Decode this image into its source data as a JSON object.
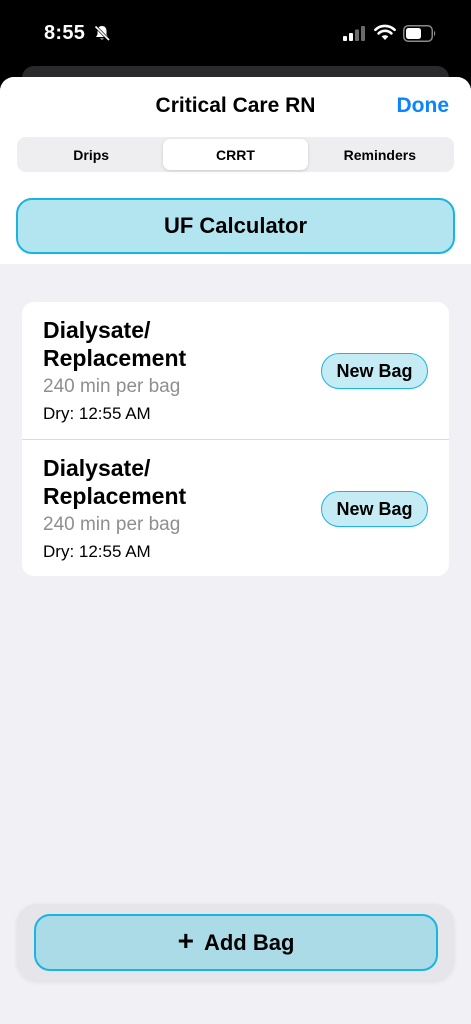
{
  "status_bar": {
    "time": "8:55",
    "icons": [
      "bell-slash-icon",
      "cellular-signal-icon",
      "wifi-icon",
      "battery-icon"
    ]
  },
  "nav": {
    "title": "Critical Care RN",
    "done_label": "Done"
  },
  "tabs": [
    {
      "label": "Drips",
      "active": false
    },
    {
      "label": "CRRT",
      "active": true
    },
    {
      "label": "Reminders",
      "active": false
    }
  ],
  "uf_calculator": {
    "label": "UF Calculator"
  },
  "bags": [
    {
      "name": "Dialysate/ Replacement",
      "rate": "240 min per bag",
      "dry": "Dry: 12:55 AM",
      "button_label": "New Bag"
    },
    {
      "name": "Dialysate/ Replacement",
      "rate": "240 min per bag",
      "dry": "Dry: 12:55 AM",
      "button_label": "New Bag"
    }
  ],
  "add_bag": {
    "icon": "plus-icon",
    "label": "Add Bag"
  },
  "colors": {
    "accent": "#0a84ff",
    "button_fill": "#b3e5f0",
    "button_border": "#1ab4e0"
  }
}
